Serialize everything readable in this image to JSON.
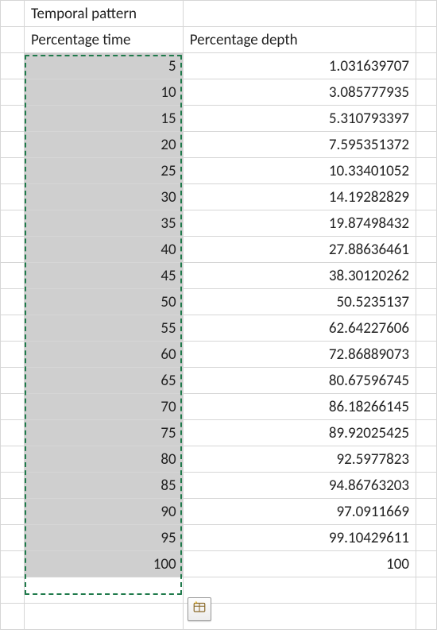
{
  "headers": {
    "title": "Temporal pattern",
    "col1": "Percentage time",
    "col2": "Percentage depth"
  },
  "rows": [
    {
      "time": "5",
      "depth": "1.031639707"
    },
    {
      "time": "10",
      "depth": "3.085777935"
    },
    {
      "time": "15",
      "depth": "5.310793397"
    },
    {
      "time": "20",
      "depth": "7.595351372"
    },
    {
      "time": "25",
      "depth": "10.33401052"
    },
    {
      "time": "30",
      "depth": "14.19282829"
    },
    {
      "time": "35",
      "depth": "19.87498432"
    },
    {
      "time": "40",
      "depth": "27.88636461"
    },
    {
      "time": "45",
      "depth": "38.30120262"
    },
    {
      "time": "50",
      "depth": "50.5235137"
    },
    {
      "time": "55",
      "depth": "62.64227606"
    },
    {
      "time": "60",
      "depth": "72.86889073"
    },
    {
      "time": "65",
      "depth": "80.67596745"
    },
    {
      "time": "70",
      "depth": "86.18266145"
    },
    {
      "time": "75",
      "depth": "89.92025425"
    },
    {
      "time": "80",
      "depth": "92.5977823"
    },
    {
      "time": "85",
      "depth": "94.86763203"
    },
    {
      "time": "90",
      "depth": "97.0911669"
    },
    {
      "time": "95",
      "depth": "99.10429611"
    },
    {
      "time": "100",
      "depth": "100"
    }
  ],
  "icons": {
    "quick_analysis": "quick-analysis-icon"
  }
}
